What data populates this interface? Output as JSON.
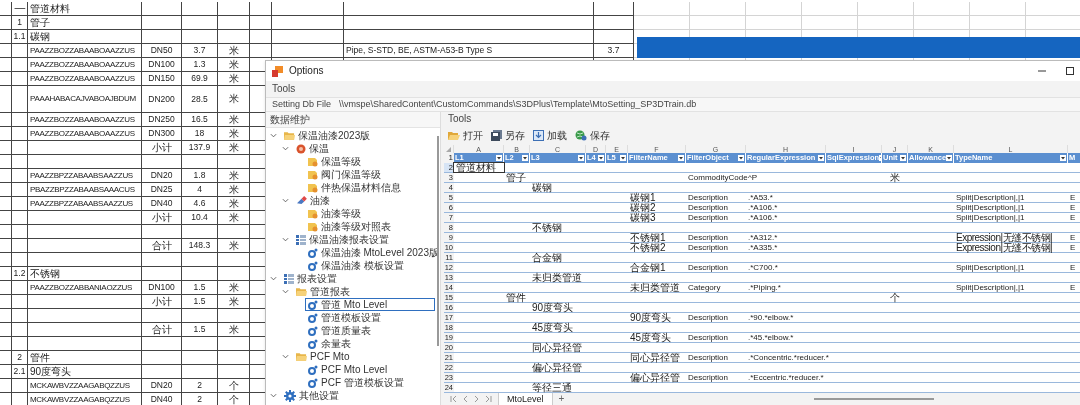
{
  "background_sheet": {
    "rows": [
      {
        "kind": "item",
        "index": "一",
        "name": "管道材料"
      },
      {
        "kind": "item",
        "index": "1",
        "name": "管子"
      },
      {
        "kind": "item",
        "index": "1.1",
        "name": "碳钢"
      },
      {
        "kind": "item",
        "name": "PAAZZBOZZABAABOAAZZUS",
        "size": "DN50",
        "quantity": "3.7",
        "unit": "米",
        "description": "Pipe, S-STD, BE, ASTM-A53-B Type S",
        "column_10": "3.7"
      },
      {
        "kind": "item",
        "name": "PAAZZBOZZABAABOAAZZUS",
        "size": "DN100",
        "quantity": "1.3",
        "unit": "米"
      },
      {
        "kind": "item",
        "name": "PAAZZBOZZABAABOAAZZUS",
        "size": "DN150",
        "quantity": "69.9",
        "unit": "米"
      },
      {
        "kind": "tall",
        "name": "PAAAHABACAJVABOAJBDUM",
        "size": "DN200",
        "quantity": "28.5",
        "unit": "米"
      },
      {
        "kind": "item",
        "name": "PAAZZBOZZABAABOAAZZUS",
        "size": "DN250",
        "quantity": "16.5",
        "unit": "米"
      },
      {
        "kind": "item",
        "name": "PAAZZBOZZABAABOAAZZUS",
        "size": "DN300",
        "quantity": "18",
        "unit": "米"
      },
      {
        "kind": "item",
        "size": "小计",
        "quantity": "137.9",
        "unit": "米"
      },
      {
        "kind": "blank"
      },
      {
        "kind": "item",
        "name": "PAAZZBPZZABAABSAAZZUS",
        "size": "DN20",
        "quantity": "1.8",
        "unit": "米"
      },
      {
        "kind": "item",
        "name": "PBAZZBPZZABAABSAAACUS",
        "size": "DN25",
        "quantity": "4",
        "unit": "米"
      },
      {
        "kind": "item",
        "name": "PAAZZBPZZABAABSAAZZUS",
        "size": "DN40",
        "quantity": "4.6",
        "unit": "米"
      },
      {
        "kind": "item",
        "size": "小计",
        "quantity": "10.4",
        "unit": "米"
      },
      {
        "kind": "blank"
      },
      {
        "kind": "item",
        "size": "合计",
        "quantity": "148.3",
        "unit": "米"
      },
      {
        "kind": "blank"
      },
      {
        "kind": "item",
        "index": "1.2",
        "name": "不锈钢"
      },
      {
        "kind": "item",
        "name": "PAAZZBOZZABBANIAOZZUS",
        "size": "DN100",
        "quantity": "1.5",
        "unit": "米"
      },
      {
        "kind": "item",
        "size": "小计",
        "quantity": "1.5",
        "unit": "米"
      },
      {
        "kind": "blank"
      },
      {
        "kind": "item",
        "size": "合计",
        "quantity": "1.5",
        "unit": "米"
      },
      {
        "kind": "blank"
      },
      {
        "kind": "item",
        "index": "2",
        "name": "管件"
      },
      {
        "kind": "item",
        "index": "2.1",
        "name": "90度弯头"
      },
      {
        "kind": "item",
        "name": "MCKAWBVZZAAGABQZZUS",
        "size": "DN20",
        "quantity": "2",
        "unit": "个"
      },
      {
        "kind": "item",
        "name": "MCKAWBVZZAAGABQZZUS",
        "size": "DN40",
        "quantity": "2",
        "unit": "个"
      }
    ]
  },
  "window": {
    "title": "Options",
    "menu": [
      "Tools"
    ],
    "setting_label": "Setting Db File",
    "setting_path": "\\\\vmspe\\SharedContent\\CustomCommands\\S3DPlus\\Template\\MtoSetting_SP3DTrain.db",
    "sidebar": {
      "title": "数据维护",
      "tree": [
        {
          "label": "保温油漆2023版",
          "kind": "folder",
          "expanded": true,
          "selected": false,
          "children": [
            {
              "label": "保温",
              "kind": "insulation",
              "expanded": true,
              "selected": false,
              "children": [
                {
                  "label": "保温等级",
                  "kind": "document",
                  "selected": false
                },
                {
                  "label": "阀门保温等级",
                  "kind": "document",
                  "selected": false
                },
                {
                  "label": "伴热保温材料信息",
                  "kind": "document",
                  "selected": false
                }
              ]
            },
            {
              "label": "油漆",
              "kind": "paint",
              "expanded": true,
              "selected": false,
              "children": [
                {
                  "label": "油漆等级",
                  "kind": "document",
                  "selected": false
                },
                {
                  "label": "油漆等级对照表",
                  "kind": "document",
                  "selected": false
                }
              ]
            },
            {
              "label": "保温油漆报表设置",
              "kind": "table",
              "expanded": true,
              "selected": false,
              "children": [
                {
                  "label": "保温油漆 MtoLevel 2023版",
                  "kind": "gear",
                  "selected": false
                },
                {
                  "label": "保温油漆 模板设置",
                  "kind": "gear",
                  "selected": false
                }
              ]
            }
          ]
        },
        {
          "label": "报表设置",
          "kind": "table",
          "expanded": true,
          "selected": false,
          "children": [
            {
              "label": "管道报表",
              "kind": "folder",
              "expanded": true,
              "selected": false,
              "children": [
                {
                  "label": "管道 Mto Level",
                  "kind": "gear",
                  "selected": true
                },
                {
                  "label": "管道模板设置",
                  "kind": "gear",
                  "selected": false
                },
                {
                  "label": "管道质量表",
                  "kind": "gear",
                  "selected": false
                },
                {
                  "label": "余量表",
                  "kind": "gear",
                  "selected": false
                }
              ]
            },
            {
              "label": "PCF Mto",
              "kind": "folder",
              "expanded": true,
              "selected": false,
              "children": [
                {
                  "label": "PCF Mto Level",
                  "kind": "gear",
                  "selected": false
                },
                {
                  "label": "PCF 管道模板设置",
                  "kind": "gear",
                  "selected": false
                }
              ]
            }
          ]
        },
        {
          "label": "其他设置",
          "kind": "settings",
          "expanded": true,
          "selected": false
        }
      ]
    },
    "panel_title": "Tools",
    "toolbar": [
      {
        "label": "打开",
        "kind": "open"
      },
      {
        "label": "另存",
        "kind": "save_as"
      },
      {
        "label": "加载",
        "kind": "load"
      },
      {
        "label": "保存",
        "kind": "save"
      }
    ],
    "grid": {
      "header_number": "1",
      "columns": [
        {
          "letter": "A",
          "name": "L1"
        },
        {
          "letter": "B",
          "name": "L2"
        },
        {
          "letter": "C",
          "name": "L3"
        },
        {
          "letter": "D",
          "name": "L4"
        },
        {
          "letter": "E",
          "name": "L5"
        },
        {
          "letter": "F",
          "name": "FilterName"
        },
        {
          "letter": "G",
          "name": "FilterObject"
        },
        {
          "letter": "H",
          "name": "RegularExpression"
        },
        {
          "letter": "I",
          "name": "SqlExpression"
        },
        {
          "letter": "J",
          "name": "Unit"
        },
        {
          "letter": "K",
          "name": "Allowance"
        },
        {
          "letter": "L",
          "name": "TypeName"
        },
        {
          "name": "M"
        }
      ],
      "rows": [
        {
          "number": "2",
          "selected": true,
          "cells": {
            "A": "管道材料"
          }
        },
        {
          "number": "3",
          "selected": false,
          "cells": {
            "B": "管子",
            "G": "CommodityCode",
            "H": "^P",
            "J": "米"
          }
        },
        {
          "number": "4",
          "selected": false,
          "cells": {
            "C": "碳钢"
          }
        },
        {
          "number": "5",
          "selected": false,
          "cells": {
            "F": "碳钢1",
            "G": "Description",
            "H": ".*A53.*",
            "L": "Split|Description|,|1",
            "M": "E"
          }
        },
        {
          "number": "6",
          "selected": false,
          "cells": {
            "F": "碳钢2",
            "G": "Description",
            "H": ".*A106.*",
            "L": "Split|Description|,|1",
            "M": "E"
          }
        },
        {
          "number": "7",
          "selected": false,
          "cells": {
            "F": "碳钢3",
            "G": "Description",
            "H": ".*A106.*",
            "L": "Split|Description|,|1",
            "M": "E"
          }
        },
        {
          "number": "8",
          "selected": false,
          "cells": {
            "C": "不锈钢"
          }
        },
        {
          "number": "9",
          "selected": false,
          "cells": {
            "F": "不锈钢1",
            "G": "Description",
            "H": ".*A312.*",
            "L": "Expression|无缝不锈钢|",
            "M": "E"
          }
        },
        {
          "number": "10",
          "selected": false,
          "cells": {
            "F": "不锈钢2",
            "G": "Description",
            "H": ".*A335.*",
            "L": "Expression|无缝不锈钢|",
            "M": "E"
          }
        },
        {
          "number": "11",
          "selected": false,
          "cells": {
            "C": "合金钢"
          }
        },
        {
          "number": "12",
          "selected": false,
          "cells": {
            "F": "合金钢1",
            "G": "Description",
            "H": ".*C700.*",
            "L": "Split|Description|,|1",
            "M": "E"
          }
        },
        {
          "number": "13",
          "selected": false,
          "cells": {
            "C": "未归类管道"
          }
        },
        {
          "number": "14",
          "selected": false,
          "cells": {
            "F": "未归类管道",
            "G": "Category",
            "H": ".*Piping.*",
            "L": "Split|Description|,|1",
            "M": "E"
          }
        },
        {
          "number": "15",
          "selected": false,
          "cells": {
            "B": "管件",
            "J": "个"
          }
        },
        {
          "number": "16",
          "selected": false,
          "cells": {
            "C": "90度弯头"
          }
        },
        {
          "number": "17",
          "selected": false,
          "cells": {
            "F": "90度弯头",
            "G": "Description",
            "H": ".*90.*elbow.*"
          }
        },
        {
          "number": "18",
          "selected": false,
          "cells": {
            "C": "45度弯头"
          }
        },
        {
          "number": "19",
          "selected": false,
          "cells": {
            "F": "45度弯头",
            "G": "Description",
            "H": ".*45.*elbow.*"
          }
        },
        {
          "number": "20",
          "selected": false,
          "cells": {
            "C": "同心异径管"
          }
        },
        {
          "number": "21",
          "selected": false,
          "cells": {
            "F": "同心异径管",
            "G": "Description",
            "H": ".*Concentric.*reducer.*"
          }
        },
        {
          "number": "22",
          "selected": false,
          "cells": {
            "C": "偏心异径管"
          }
        },
        {
          "number": "23",
          "selected": false,
          "cells": {
            "F": "偏心异径管",
            "G": "Description",
            "H": ".*Eccentric.*reducer.*"
          }
        },
        {
          "number": "24",
          "selected": false,
          "cells": {
            "C": "等径三通"
          }
        }
      ]
    },
    "sheet_tabs": [
      {
        "label": "MtoLevel",
        "selected": true
      }
    ],
    "add_tab": "+"
  }
}
